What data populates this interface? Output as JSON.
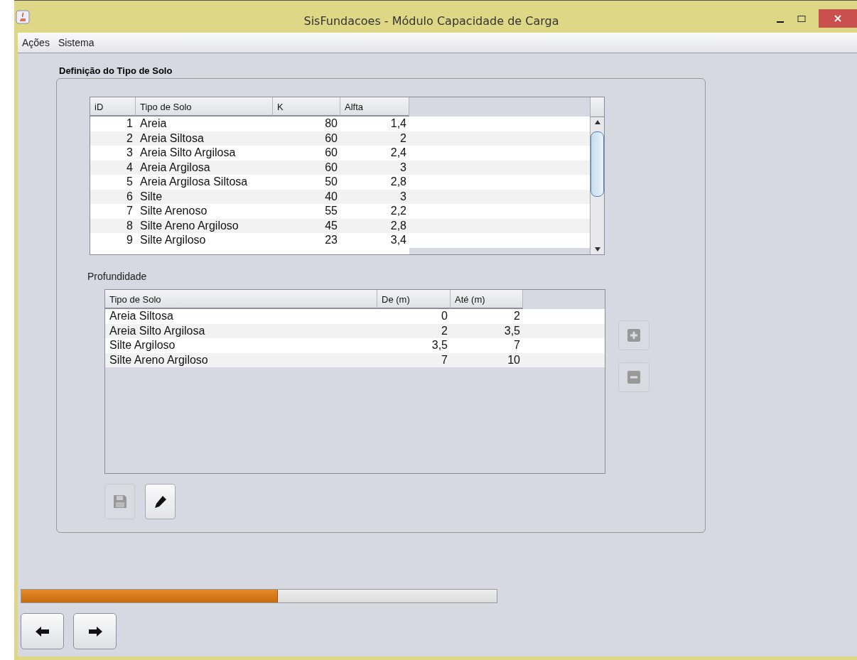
{
  "window": {
    "title": "SisFundacoes - Módulo Capacidade de Carga"
  },
  "menu": [
    "Ações",
    "Sistema"
  ],
  "soil_panel": {
    "title": "Definição do Tipo de Solo",
    "table": {
      "columns": [
        "iD",
        "Tipo de Solo",
        "K",
        "Alfta"
      ],
      "rows": [
        [
          "1",
          "Areia",
          "80",
          "1,4"
        ],
        [
          "2",
          "Areia Siltosa",
          "60",
          "2"
        ],
        [
          "3",
          "Areia Silto Argilosa",
          "60",
          "2,4"
        ],
        [
          "4",
          "Areia Argilosa",
          "60",
          "3"
        ],
        [
          "5",
          "Areia Argilosa Siltosa",
          "50",
          "2,8"
        ],
        [
          "6",
          "Silte",
          "40",
          "3"
        ],
        [
          "7",
          "Silte Arenoso",
          "55",
          "2,2"
        ],
        [
          "8",
          "Silte Areno Argiloso",
          "45",
          "2,8"
        ],
        [
          "9",
          "Silte Argiloso",
          "23",
          "3,4"
        ]
      ]
    },
    "depth_label": "Profundidade",
    "depth_table": {
      "columns": [
        "Tipo de Solo",
        "De (m)",
        "Até (m)"
      ],
      "rows": [
        [
          "Areia Siltosa",
          "0",
          "2"
        ],
        [
          "Areia Silto Argilosa",
          "2",
          "3,5"
        ],
        [
          "Silte Argiloso",
          "3,5",
          "7"
        ],
        [
          "Silte Areno Argiloso",
          "7",
          "10"
        ]
      ]
    },
    "add_button": {
      "disabled": true
    },
    "remove_button": {
      "disabled": true
    },
    "save_button": {
      "disabled": true
    },
    "edit_button": {
      "disabled": false
    }
  },
  "progress": {
    "level": 0.54
  },
  "nav_buttons": [
    {
      "kind": "back"
    },
    {
      "kind": "forward"
    }
  ]
}
